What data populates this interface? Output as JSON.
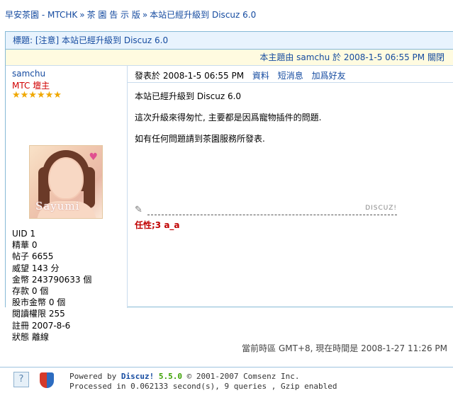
{
  "breadcrumb": {
    "items": [
      "早安茶園 - MTCHK",
      "茶 園 告 示 版",
      "本站已經升級到 Discuz 6.0"
    ],
    "separator": "»"
  },
  "thread": {
    "title": "標題: [注意] 本站已經升級到 Discuz 6.0",
    "info_prefix": "本主題由 samchu 於 2008-1-5 06:55 PM",
    "info_action": "關閉"
  },
  "author": {
    "name": "samchu",
    "group": "MTC 壇主",
    "stars": "★★★★★★",
    "avatar_signature": "Sayumi",
    "stats": [
      "UID 1",
      "精華 0",
      "帖子 6655",
      "威望 143 分",
      "金幣 243790633 個",
      "存款 0 個",
      "股市金幣 0 個",
      "閱讀權限 255",
      "註冊 2007-8-6",
      "狀態 離線"
    ]
  },
  "post": {
    "posted_at": "發表於 2008-1-5 06:55 PM",
    "actions": [
      "資料",
      "短消息",
      "加爲好友"
    ],
    "paragraphs": [
      "本站已經升級到 Discuz 6.0",
      "這次升級來得匆忙, 主要都是因爲寵物插件的問題.",
      "如有任何問題請到茶園服務所發表."
    ],
    "sig_brand": "DISCUZ!",
    "signature": "任性;3 a_a"
  },
  "footer": {
    "timezone": "當前時區 GMT+8, 現在時間是 2008-1-27 11:26 PM",
    "powered_prefix": "Powered by",
    "brand": "Discuz!",
    "version": "5.5.0",
    "copyright": "© 2001-2007 Comsenz Inc.",
    "processed": "Processed in 0.062133 second(s), 9 queries , Gzip enabled"
  },
  "colors": {
    "link": "#154ba0",
    "group": "#d00000",
    "signature": "#c00000",
    "title_bg": "#e8f3fd",
    "info_bg": "#fffbe0",
    "border": "#86b9d6"
  }
}
